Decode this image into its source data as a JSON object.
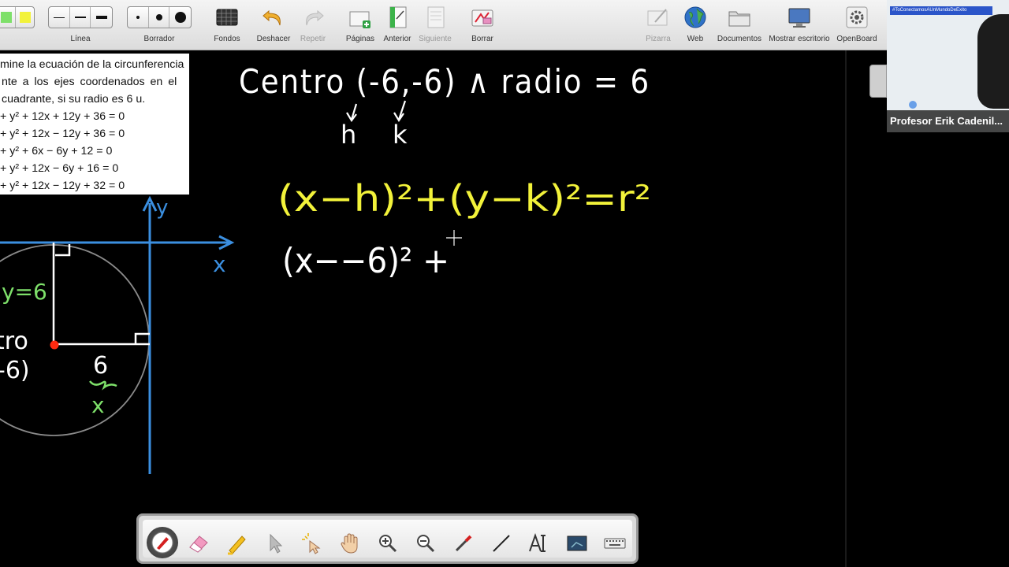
{
  "toolbar": {
    "linea_label": "Línea",
    "borrador_label": "Borrador",
    "fondos_label": "Fondos",
    "deshacer_label": "Deshacer",
    "repetir_label": "Repetir",
    "paginas_label": "Páginas",
    "anterior_label": "Anterior",
    "siguiente_label": "Siguiente",
    "borrar_label": "Borrar",
    "pizarra_label": "Pizarra",
    "web_label": "Web",
    "documentos_label": "Documentos",
    "mostrar_label": "Mostrar escritorio",
    "openboard_label": "OpenBoard"
  },
  "statement": {
    "line1": "mine la ecuación de la circunferencia",
    "line2": "nte a los ejes coordenados en el",
    "line3": "cuadrante, si su radio es 6 u.",
    "opt_a": "+ y² + 12x + 12y + 36 = 0",
    "opt_b": "+ y² + 12x − 12y + 36 = 0",
    "opt_c": "+ y² + 6x − 6y + 12 = 0",
    "opt_d": "+ y² + 12x − 6y + 16 = 0",
    "opt_e": "+ y² + 12x − 12y + 32 = 0"
  },
  "ink": {
    "centro_text": "Centro (-6,-6) ∧ radio = 6",
    "h_label": "h",
    "k_label": "k",
    "formula": "(x−h)²+(y−k)²=r²",
    "partial": "(x−−6)² +",
    "axis_y": "y",
    "axis_x": "x",
    "y_eq": "y=6",
    "centro_word": "tro",
    "centro_coord": "-6)",
    "six": "6",
    "x_label": "x"
  },
  "colors": {
    "ink_white": "#ffffff",
    "ink_yellow": "#f2f23a",
    "ink_blue": "#3b8fe0",
    "ink_green": "#7ee06a",
    "center_red": "#ff2a10"
  },
  "webcam": {
    "tag": "#ToConectamosAUnMundoDeExito",
    "name": "Profesor Erik Cadenil..."
  },
  "floatbar_icons": [
    "pen-icon",
    "eraser-icon",
    "highlighter-icon",
    "pointer-icon",
    "laser-icon",
    "hand-icon",
    "zoom-in-icon",
    "zoom-out-icon",
    "capture-icon",
    "line-icon",
    "text-icon",
    "board-icon",
    "keyboard-icon"
  ]
}
